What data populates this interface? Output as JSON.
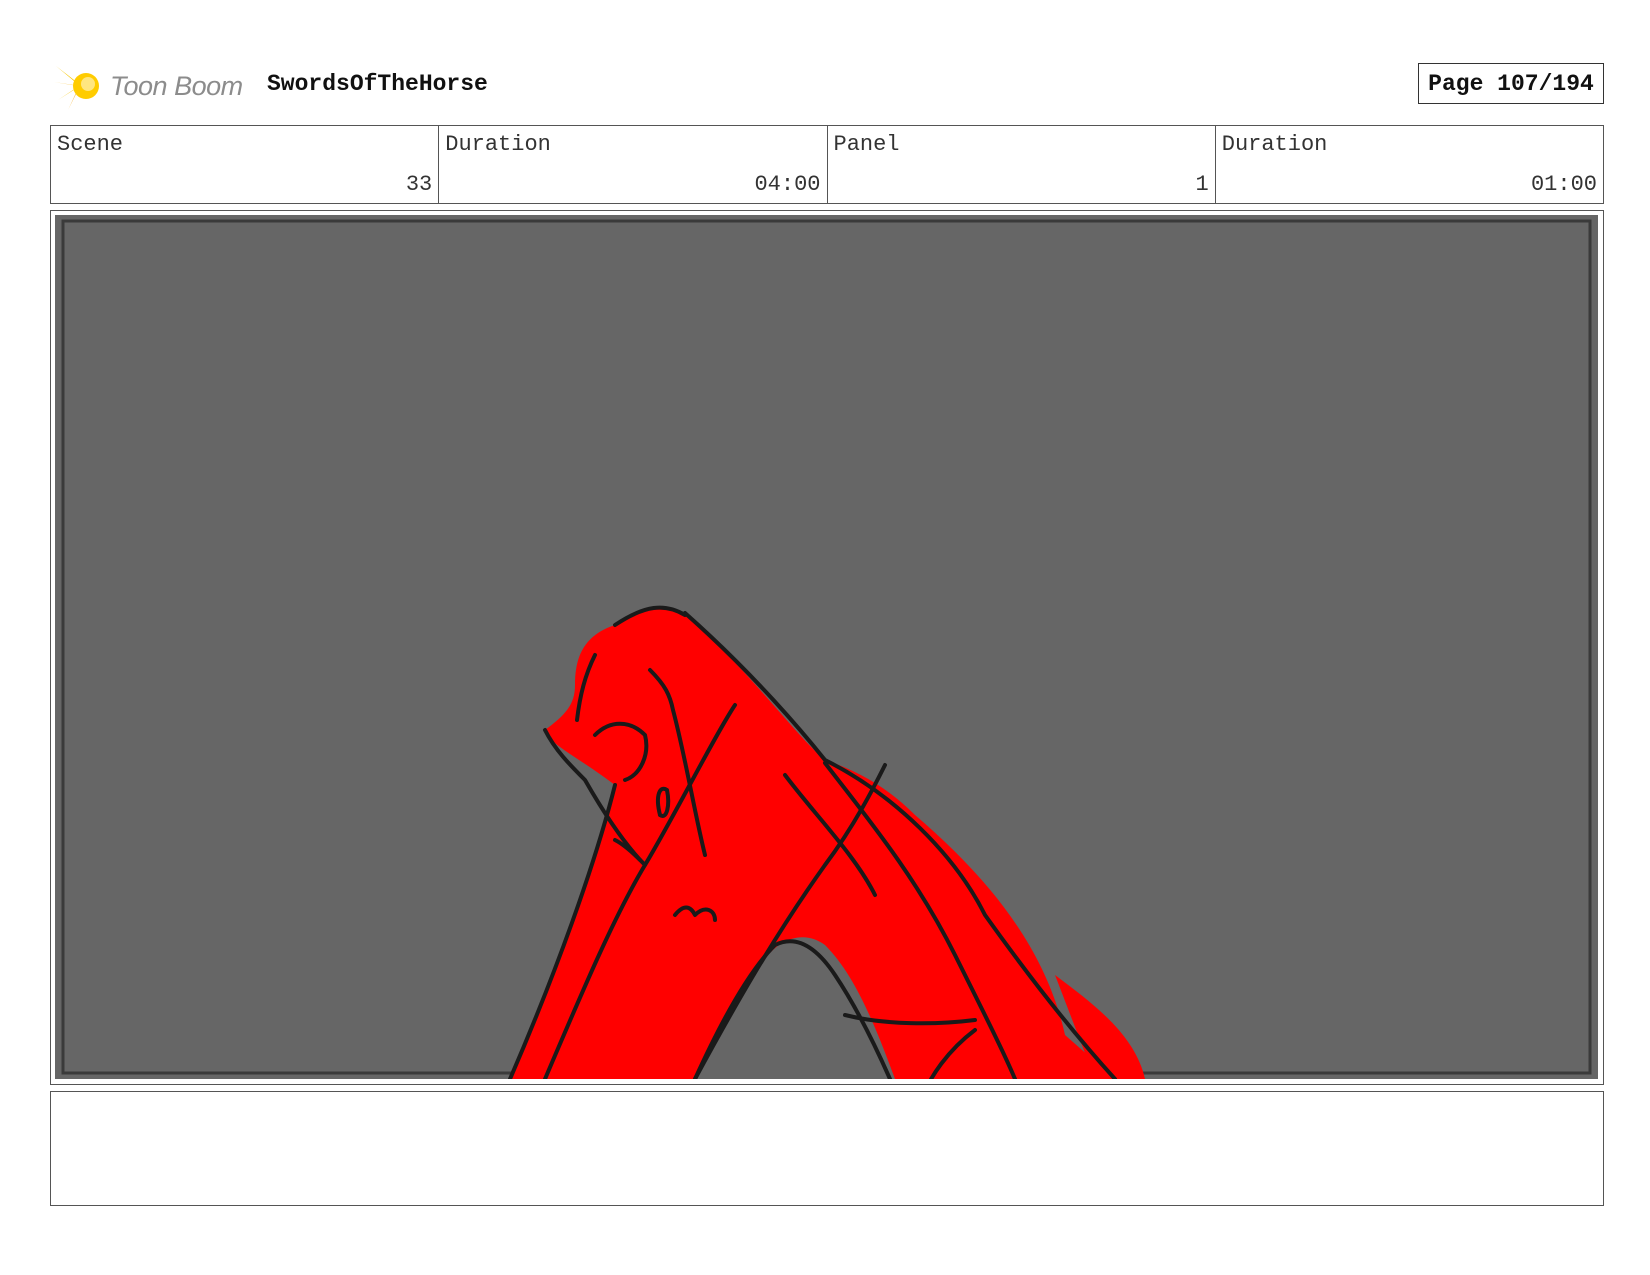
{
  "header": {
    "logo_text": "Toon Boom",
    "project_title": "SwordsOfTheHorse",
    "page_label": "Page 107/194"
  },
  "info": {
    "scene_label": "Scene",
    "scene_value": "33",
    "scene_duration_label": "Duration",
    "scene_duration_value": "04:00",
    "panel_label": "Panel",
    "panel_value": "1",
    "panel_duration_label": "Duration",
    "panel_duration_value": "01:00"
  },
  "artwork": {
    "background_color": "#666666",
    "figure_color": "#ff0000",
    "line_color": "#1a1a1a"
  },
  "notes": {
    "text": ""
  }
}
